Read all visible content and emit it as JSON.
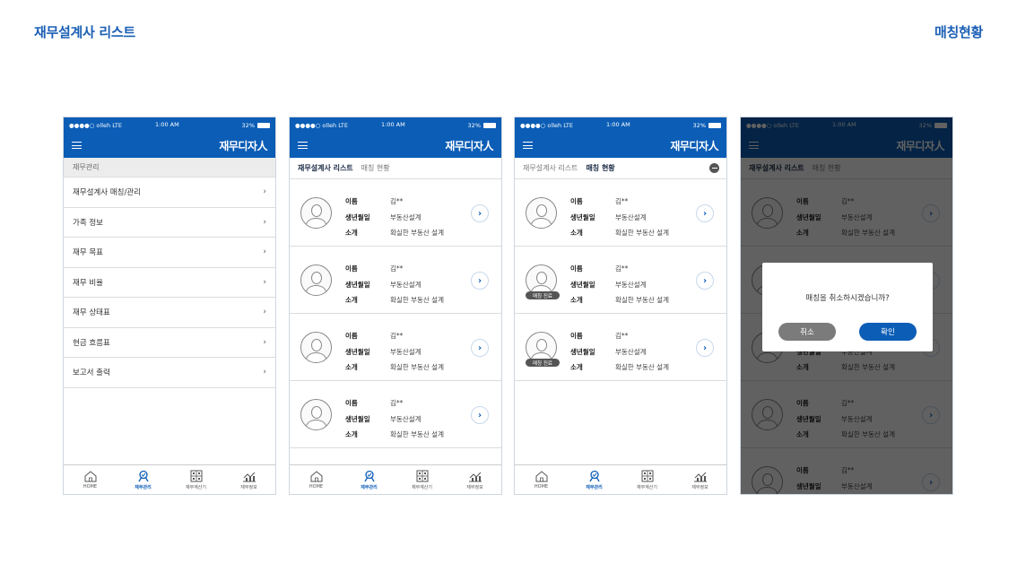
{
  "header": {
    "title": "재무설계사 리스트",
    "right_title": "매칭현황"
  },
  "status_bar": {
    "carrier": "●●●●○ olleh LTE",
    "time": "1:00 AM",
    "battery": "32%"
  },
  "app": {
    "logo": "재무디자人"
  },
  "tabbar": {
    "home": "HOME",
    "manage": "재무관리",
    "calc": "재무계산기",
    "info": "재무정보"
  },
  "screen1": {
    "section": "재무관리",
    "items": [
      {
        "label": "재무설계사 매칭/관리"
      },
      {
        "label": "가족 정보"
      },
      {
        "label": "재무 목표"
      },
      {
        "label": "재무 비율"
      },
      {
        "label": "재무 상태표"
      },
      {
        "label": "현금 흐름표"
      },
      {
        "label": "보고서 출력"
      }
    ],
    "chevron": "›"
  },
  "list_tabs": {
    "list": "재무설계사 리스트",
    "status": "매칭 현황"
  },
  "card": {
    "name_label": "이름",
    "name_value": "김**",
    "birth_label": "생년월일",
    "birth_value": "부동산설계",
    "intro_label": "소개",
    "intro_value": "확실한 부동산 설계",
    "badge": "매칭 진료",
    "go": "›"
  },
  "dialog": {
    "message": "매칭을 취소하시겠습니까?",
    "cancel": "취소",
    "ok": "확인"
  },
  "colors": {
    "brand_blue": "#0b5db6",
    "title_blue": "#1a5fb4",
    "dim_overlay": "rgba(0,0,0,0.62)"
  }
}
